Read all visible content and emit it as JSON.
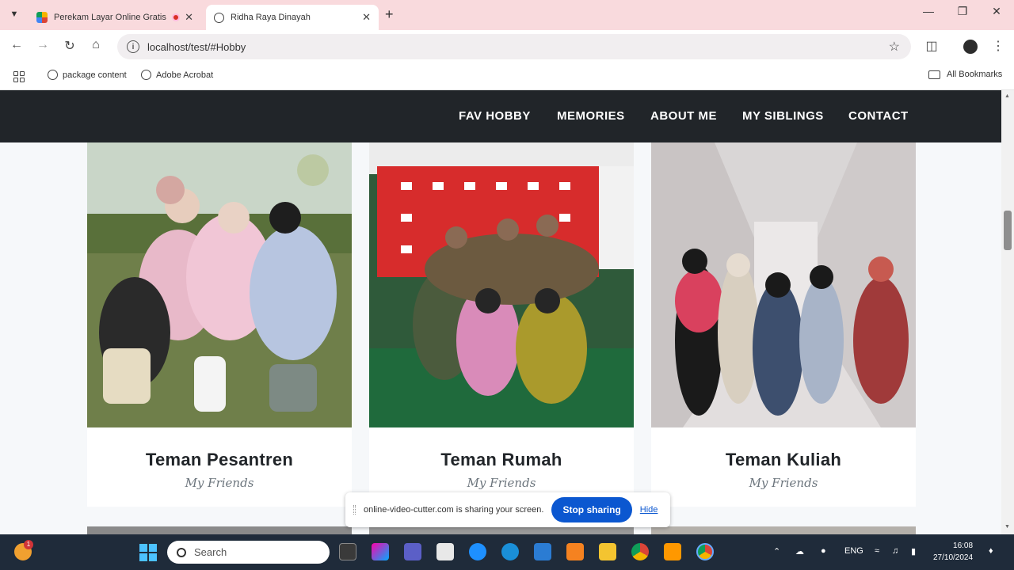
{
  "browser": {
    "tabs": [
      {
        "title": "Perekam Layar Online Gratis",
        "active": false
      },
      {
        "title": "Ridha Raya Dinayah",
        "active": true
      }
    ],
    "url": "localhost/test/#Hobby",
    "bookmarks": [
      "package content",
      "Adobe Acrobat"
    ],
    "all_bookmarks_label": "All Bookmarks"
  },
  "site": {
    "nav": [
      "FAV HOBBY",
      "MEMORIES",
      "ABOUT ME",
      "MY SIBLINGS",
      "CONTACT"
    ],
    "cards": [
      {
        "title": "Teman Pesantren",
        "subtitle": "My Friends"
      },
      {
        "title": "Teman Rumah",
        "subtitle": "My Friends"
      },
      {
        "title": "Teman Kuliah",
        "subtitle": "My Friends"
      }
    ]
  },
  "share_banner": {
    "message": "online-video-cutter.com is sharing your screen.",
    "stop_label": "Stop sharing",
    "hide_label": "Hide"
  },
  "taskbar": {
    "search_placeholder": "Search",
    "notification_count": "1",
    "language": "ENG",
    "time": "16:08",
    "date": "27/10/2024"
  },
  "colors": {
    "nav_bg": "#212529",
    "accent_blue": "#0b57d0",
    "tabstrip": "#f9dadd",
    "taskbar": "#1f2b3a"
  }
}
